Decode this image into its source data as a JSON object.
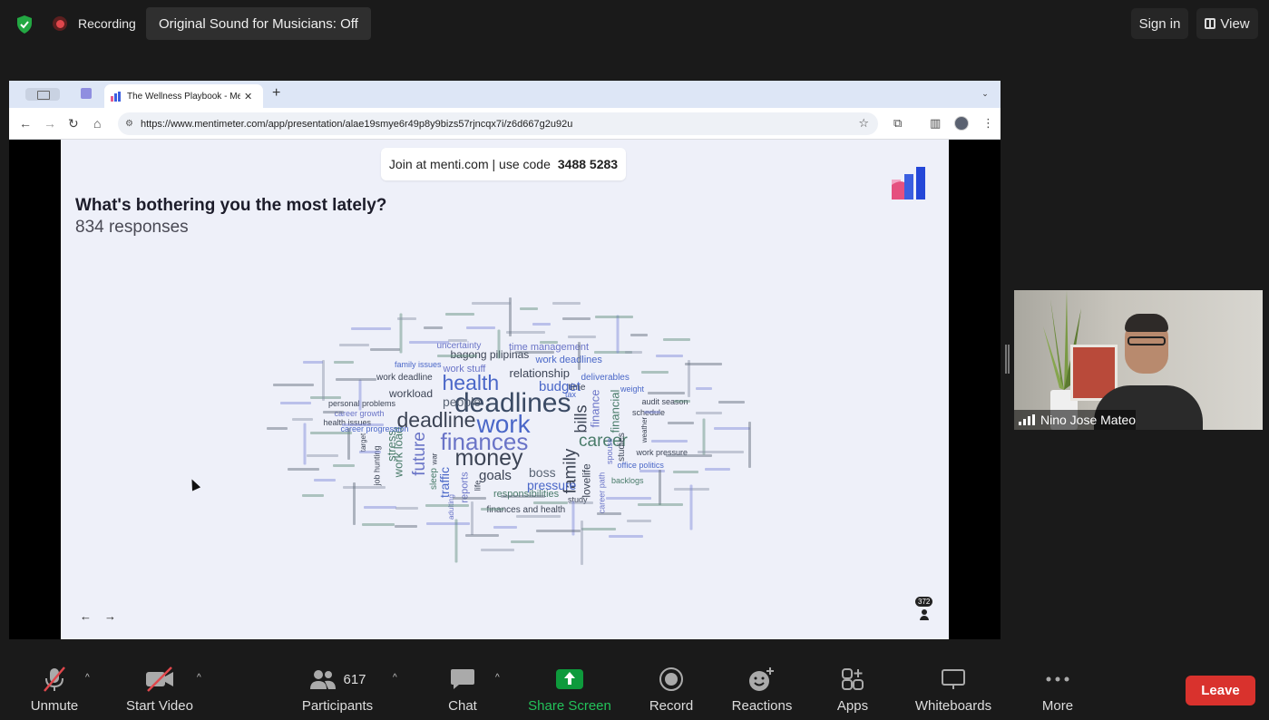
{
  "topbar": {
    "recording_label": "Recording",
    "sound_button": "Original Sound for Musicians: Off",
    "sign_in": "Sign in",
    "view": "View"
  },
  "browser": {
    "tab_title": "The Wellness Playbook - Mentimeter",
    "url": "https://www.mentimeter.com/app/presentation/alae19smye6r49p8y9bizs57rjncqx7i/z6d667g2u92u"
  },
  "slide": {
    "join_text": "Join at menti.com | use code",
    "join_code": "3488 5283",
    "question": "What's bothering you the most lately?",
    "responses": "834 responses",
    "participant_count": "372"
  },
  "wordcloud": {
    "words": [
      {
        "text": "deadlines",
        "size": 30,
        "color": "#3a4a64",
        "rot": 0
      },
      {
        "text": "work",
        "size": 28,
        "color": "#4a67c8",
        "rot": 0
      },
      {
        "text": "finances",
        "size": 26,
        "color": "#6a74c7",
        "rot": 0
      },
      {
        "text": "money",
        "size": 25,
        "color": "#3c4455",
        "rot": 0
      },
      {
        "text": "deadline",
        "size": 23,
        "color": "#3c4455",
        "rot": 0
      },
      {
        "text": "health",
        "size": 23,
        "color": "#4a67c8",
        "rot": 0
      },
      {
        "text": "career",
        "size": 19,
        "color": "#4a7c6a",
        "rot": 0
      },
      {
        "text": "future",
        "size": 19,
        "color": "#6a74c7",
        "rot": -90
      },
      {
        "text": "family",
        "size": 19,
        "color": "#3c4455",
        "rot": -90
      },
      {
        "text": "bills",
        "size": 18,
        "color": "#3c4455",
        "rot": -90
      },
      {
        "text": "budget",
        "size": 15,
        "color": "#4a67c8",
        "rot": 0
      },
      {
        "text": "goals",
        "size": 15,
        "color": "#3c4455",
        "rot": 0
      },
      {
        "text": "people",
        "size": 14,
        "color": "#5a6575",
        "rot": 0
      },
      {
        "text": "boss",
        "size": 14,
        "color": "#5a6575",
        "rot": 0
      },
      {
        "text": "pressure",
        "size": 14,
        "color": "#4a67c8",
        "rot": 0
      },
      {
        "text": "relationship",
        "size": 13,
        "color": "#3c4455",
        "rot": 0
      },
      {
        "text": "workload",
        "size": 12,
        "color": "#3c4455",
        "rot": 0
      },
      {
        "text": "work load",
        "size": 13,
        "color": "#4a7c6a",
        "rot": -90
      },
      {
        "text": "traffic",
        "size": 14,
        "color": "#4a67c8",
        "rot": -90
      },
      {
        "text": "stress",
        "size": 13,
        "color": "#4a7c6a",
        "rot": -90
      },
      {
        "text": "financial",
        "size": 13,
        "color": "#4a7c6a",
        "rot": -90
      },
      {
        "text": "finance",
        "size": 13,
        "color": "#6a74c7",
        "rot": -90
      },
      {
        "text": "lovelife",
        "size": 12,
        "color": "#3c4455",
        "rot": -90
      },
      {
        "text": "bagong pilipinas",
        "size": 12,
        "color": "#3c4455",
        "rot": 0
      },
      {
        "text": "work deadlines",
        "size": 11,
        "color": "#4a67c8",
        "rot": 0
      },
      {
        "text": "work stuff",
        "size": 11,
        "color": "#6a74c7",
        "rot": 0
      },
      {
        "text": "time management",
        "size": 11,
        "color": "#6a74c7",
        "rot": 0
      },
      {
        "text": "responsibilities",
        "size": 11,
        "color": "#4a7c6a",
        "rot": 0
      },
      {
        "text": "finances and health",
        "size": 10,
        "color": "#3c4455",
        "rot": 0
      },
      {
        "text": "deliverables",
        "size": 10,
        "color": "#4a67c8",
        "rot": 0
      },
      {
        "text": "uncertainty",
        "size": 10,
        "color": "#6a74c7",
        "rot": 0
      },
      {
        "text": "work deadline",
        "size": 10,
        "color": "#3c4455",
        "rot": 0
      },
      {
        "text": "family issues",
        "size": 9,
        "color": "#4a67c8",
        "rot": 0
      },
      {
        "text": "personal problems",
        "size": 9,
        "color": "#3c4455",
        "rot": 0
      },
      {
        "text": "career growth",
        "size": 9,
        "color": "#6a74c7",
        "rot": 0
      },
      {
        "text": "health issues",
        "size": 9,
        "color": "#3c4455",
        "rot": 0
      },
      {
        "text": "career progression",
        "size": 9,
        "color": "#4a67c8",
        "rot": 0
      },
      {
        "text": "office politics",
        "size": 9,
        "color": "#4a67c8",
        "rot": 0
      },
      {
        "text": "work pressure",
        "size": 9,
        "color": "#3c4455",
        "rot": 0
      },
      {
        "text": "audit season",
        "size": 9,
        "color": "#3c4455",
        "rot": 0
      },
      {
        "text": "schedule",
        "size": 9,
        "color": "#3c4455",
        "rot": 0
      },
      {
        "text": "backlogs",
        "size": 9,
        "color": "#4a7c6a",
        "rot": 0
      },
      {
        "text": "study",
        "size": 9,
        "color": "#3c4455",
        "rot": 0
      },
      {
        "text": "time",
        "size": 10,
        "color": "#3c4455",
        "rot": 0
      },
      {
        "text": "weight",
        "size": 9,
        "color": "#4a67c8",
        "rot": 0
      },
      {
        "text": "tax",
        "size": 9,
        "color": "#4a67c8",
        "rot": 0
      },
      {
        "text": "sleep",
        "size": 10,
        "color": "#4a7c6a",
        "rot": -90
      },
      {
        "text": "reports",
        "size": 11,
        "color": "#6a74c7",
        "rot": -90
      },
      {
        "text": "job hunting",
        "size": 9,
        "color": "#3c4455",
        "rot": -90
      },
      {
        "text": "career path",
        "size": 9,
        "color": "#6a74c7",
        "rot": -90
      },
      {
        "text": "studies",
        "size": 10,
        "color": "#3c4455",
        "rot": -90
      },
      {
        "text": "spouse",
        "size": 9,
        "color": "#6a74c7",
        "rot": -90
      },
      {
        "text": "life",
        "size": 9,
        "color": "#3c4455",
        "rot": -90
      },
      {
        "text": "adulting",
        "size": 8,
        "color": "#6a74c7",
        "rot": -90
      },
      {
        "text": "target",
        "size": 8,
        "color": "#3c4455",
        "rot": -90
      },
      {
        "text": "weather",
        "size": 8,
        "color": "#3c4455",
        "rot": -90
      },
      {
        "text": "war",
        "size": 8,
        "color": "#3c4455",
        "rot": -90
      }
    ]
  },
  "toolbar": {
    "unmute": "Unmute",
    "start_video": "Start Video",
    "participants": "Participants",
    "participants_count": "617",
    "chat": "Chat",
    "share_screen": "Share Screen",
    "record": "Record",
    "reactions": "Reactions",
    "apps": "Apps",
    "whiteboards": "Whiteboards",
    "more": "More",
    "leave": "Leave"
  },
  "video": {
    "participant_name": "Nino Jose Mateo"
  },
  "colors": {
    "share_green": "#0e9a3c",
    "leave_red": "#d9322d",
    "muted_red": "#e0474c"
  }
}
